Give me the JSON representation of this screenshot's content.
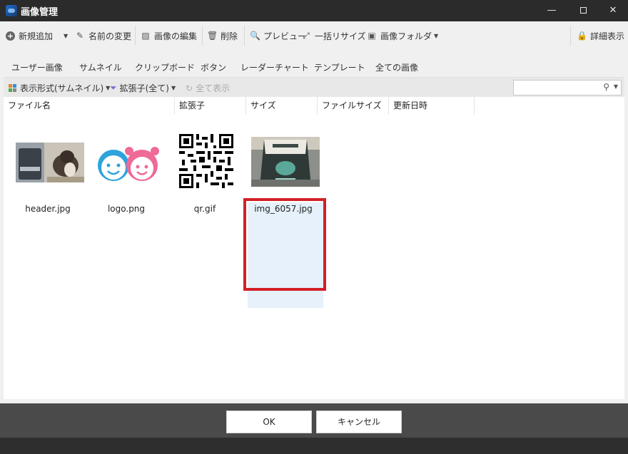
{
  "window": {
    "title": "画像管理"
  },
  "toolbar": {
    "new": "新規追加",
    "rename": "名前の変更",
    "edit": "画像の編集",
    "delete": "削除",
    "preview": "プレビュー",
    "resize": "一括リサイズ",
    "folder": "画像フォルダ",
    "details": "詳細表示"
  },
  "tabs": [
    "ユーザー画像",
    "サムネイル",
    "クリップボード",
    "ボタン",
    "レーダーチャート",
    "テンプレート",
    "全ての画像"
  ],
  "active_tab": "ユーザー画像",
  "subbar": {
    "view_mode": "表示形式(サムネイル)",
    "filter": "拡張子(全て)",
    "show_all": "全て表示",
    "search_value": ""
  },
  "columns": [
    "ファイル名",
    "拡張子",
    "サイズ",
    "ファイルサイズ",
    "更新日時"
  ],
  "files": [
    {
      "name": "header.jpg",
      "icon": "photo-cat-thumbnail"
    },
    {
      "name": "logo.png",
      "icon": "logo-faces-thumbnail"
    },
    {
      "name": "qr.gif",
      "icon": "qr-code-thumbnail"
    },
    {
      "name": "img_6057.jpg",
      "icon": "photo-bag-thumbnail",
      "selected": true
    }
  ],
  "buttons": {
    "ok": "OK",
    "cancel": "キャンセル"
  },
  "colors": {
    "accent": "#2e8fd1",
    "selection": "#d32026",
    "selected_bg": "#e6f1fb"
  }
}
